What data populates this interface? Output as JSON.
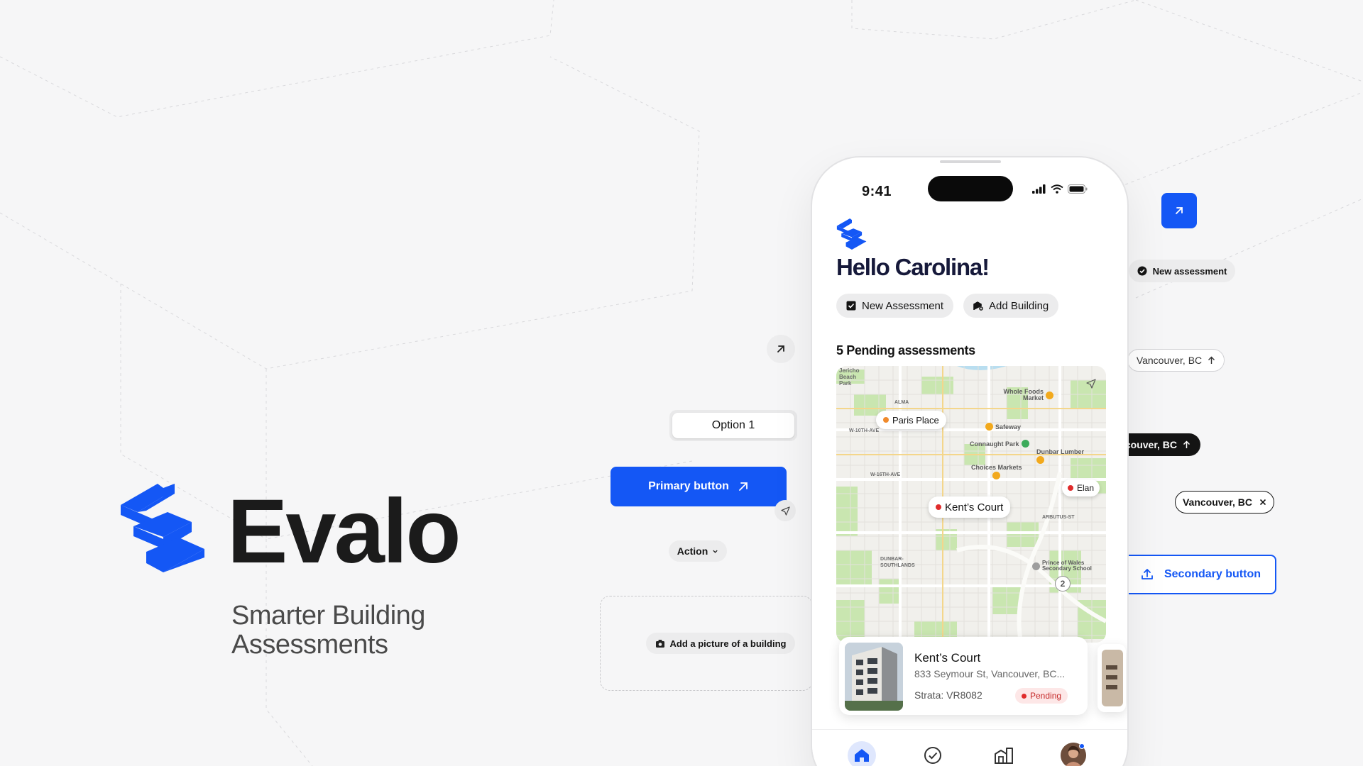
{
  "brand": {
    "name": "Evalo",
    "tagline": "Smarter Building Assessments",
    "primary_color": "#1457f5"
  },
  "components": {
    "option_label": "Option 1",
    "primary_button_label": "Primary button",
    "action_label": "Action",
    "add_picture_label": "Add a picture of a building",
    "new_assessment_chip": "New assessment",
    "location_chip_outline": "Vancouver, BC",
    "location_chip_dark": "couver, BC",
    "location_chip_removable": "Vancouver, BC",
    "secondary_button_label": "Secondary button"
  },
  "phone": {
    "status_time": "9:41",
    "greeting": "Hello Carolina!",
    "quick_actions": [
      "New Assessment",
      "Add Building"
    ],
    "pending_title": "5 Pending assessments",
    "map": {
      "pins": [
        "Paris Place",
        "Kent’s Court",
        "Elan"
      ],
      "cluster_count": "2",
      "pois": [
        "Whole Foods Market",
        "Safeway",
        "Connaught Park",
        "Dunbar Lumber",
        "Choices Markets",
        "Prince of Wales Secondary School"
      ],
      "labels": [
        "Jericho Beach Park",
        "W-10TH-AVE",
        "W-16TH-AVE",
        "DUNBAR-SOUTHLANDS",
        "ALMA",
        "ARBUTUS-ST"
      ]
    },
    "card": {
      "title": "Kent’s Court",
      "address": "833 Seymour St, Vancouver, BC...",
      "strata": "Strata: VR8082",
      "status": "Pending"
    },
    "tabs": [
      "home-icon",
      "check-circle-icon",
      "buildings-icon",
      "avatar"
    ]
  }
}
